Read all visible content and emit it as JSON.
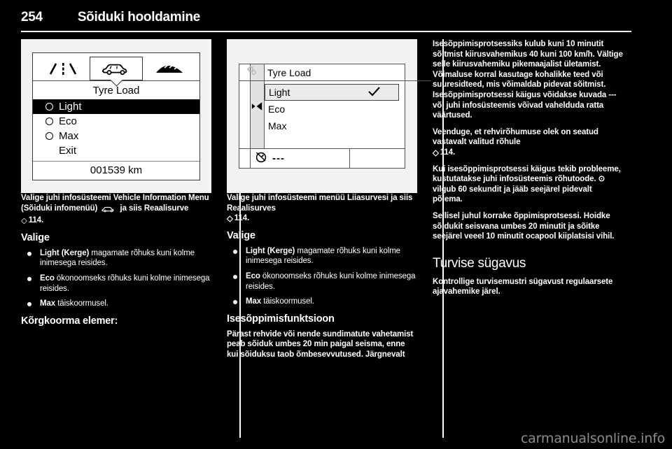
{
  "header": {
    "page_number": "254",
    "chapter_title": "Sõiduki hooldamine"
  },
  "figures": {
    "dic": {
      "tabs": [
        "road-lane-icon",
        "car-icon",
        "road-hump-icon"
      ],
      "active_tab": "car-icon",
      "title": "Tyre Load",
      "items": [
        {
          "label": "Light",
          "selected": true,
          "has_radio": true
        },
        {
          "label": "Eco",
          "selected": false,
          "has_radio": true
        },
        {
          "label": "Max",
          "selected": false,
          "has_radio": true
        },
        {
          "label": "Exit",
          "selected": false,
          "has_radio": false
        }
      ],
      "odometer": "001539 km"
    },
    "infotainment": {
      "title": "Tyre Load",
      "items": [
        {
          "label": "Light",
          "checked": true
        },
        {
          "label": "Eco",
          "checked": false
        },
        {
          "label": "Max",
          "checked": false
        }
      ],
      "footer_value": "---",
      "footer_icon": "speed-limit-icon",
      "header_icon": "settings-gear-icon",
      "scroll_icon": "left-right-arrow-icon"
    }
  },
  "col_left": {
    "p1_a": "Valige juhi infosüsteemi Vehicle Information Menu (Sõiduki infomenüü)",
    "p1_icon": "car-icon",
    "p1_b": "ja siis Reaalisurve",
    "ref1_glyph": "◇",
    "ref1": "114.",
    "h_valige": "Valige",
    "bullets": [
      {
        "bold": "Light (Kerge)",
        "rest": "magamate rõhuks kuni kolme inimesega reisides."
      },
      {
        "bold": "Eco",
        "rest": "ökonoomseks rõhuks kuni kolme inimesega reisides."
      },
      {
        "bold": "Max",
        "rest": "täiskoormusel."
      }
    ],
    "h_kiirgus": "Kõrgkoorma elemer:"
  },
  "col_mid": {
    "p1": "Valige juhi infosüsteemi menüü Liiasurvesi ja siis Reaalisurves",
    "ref1_glyph": "◇",
    "ref1": "114.",
    "h_valige": "Valige",
    "bullets": [
      {
        "bold": "Light (Kerge)",
        "rest": "magamate rõhuks kuni kolme inimesega reisides."
      },
      {
        "bold": "Eco",
        "rest": "ökonoomseks rõhuks kuni kolme inimesega reisides."
      },
      {
        "bold": "Max",
        "rest": "täiskoormusel."
      }
    ],
    "h_isoop": "Isesõppimisfunktsioon",
    "p2": "Pärast rehvide või nende sundimatute vahetamist peab sõiduk umbes 20 min paigal seisma, enne kui sõiduksu taob õmbesevvutused. Järgnevalt"
  },
  "col_right": {
    "p1": "Isesõppimisprotsessiks kulub kuni 10 minutit sõitmist kiirusvahemikus 40 kuni 100 km/h. Vältige selle kiirusvahemiku pikemaajalist ületamist. Võimaluse korral kasutage kohalikke teed või suuresidteed, mis võimaldab pidevat sõitmist. Isesõppimisprotsessi käigus võidakse kuvada --- või juhi infosüsteemis võivad vahelduda ratta väärtused.",
    "p2": "Veenduge, et rehvirõhumuse olek on seatud vastavalt valitud rõhule",
    "ref2_glyph": "◇",
    "ref2": "114.",
    "p3": "Kui isesõppimisprotsessi käigus tekib probleeme, kustutatakse juhi infosüsteemis rõhutoode. ⊙ vilgub 60 sekundit ja jääb seejärel pidevalt põlema.",
    "p4": "Sellisel juhul korrake õppimisprotsessi. Hoidke sõidukit seisvana umbes 20 minutit ja sõitke seejärel veeel 10 minutit ocapool kiiplatsisi vihil.",
    "h_turvis": "Turvise sügavus",
    "p5": "Kontrollige turvisemustri sügavust regulaarsete ajavahemike järel."
  },
  "watermark": "carmanualsonline.info"
}
